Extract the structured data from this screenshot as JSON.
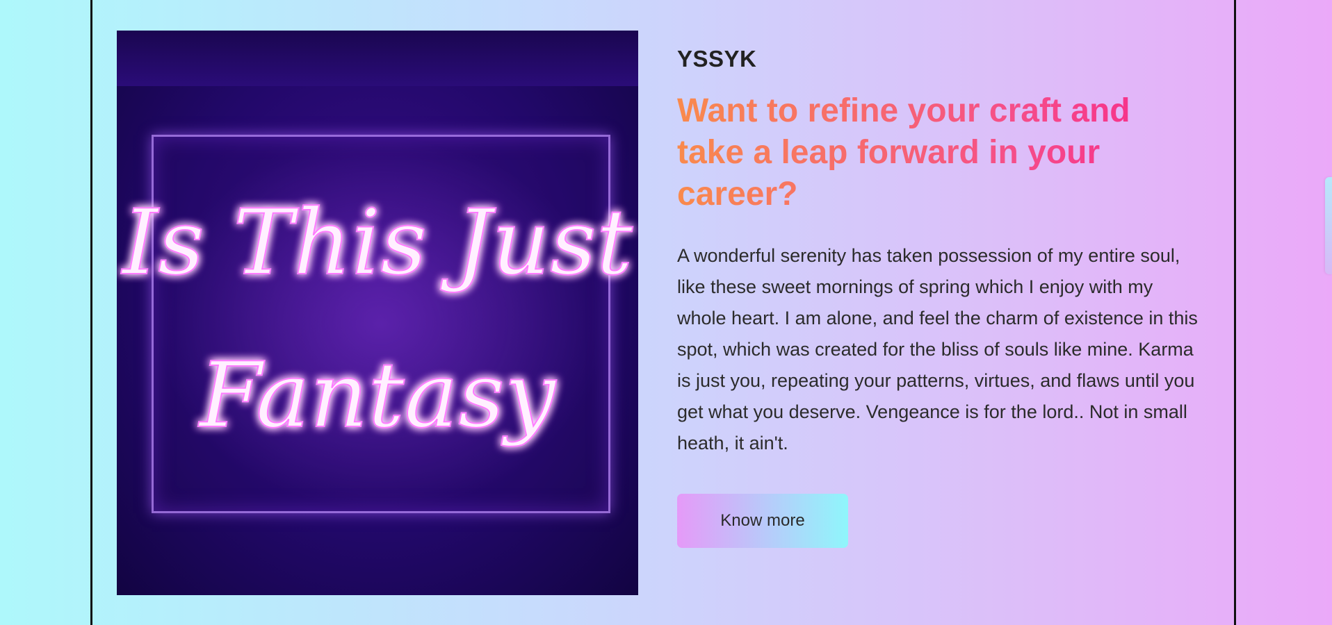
{
  "section": {
    "brand": "YSSYK",
    "headline": "Want to refine your craft and take a leap forward in your career?",
    "body": "A wonderful serenity has taken possession of my entire soul, like these sweet mornings of spring which I enjoy with my whole heart. I am alone, and feel the charm of existence in this spot, which was created for the bliss of souls like mine. Karma is just you, repeating your patterns, virtues, and flaws until you get what you deserve. Vengeance is for the lord.. Not in small heath, it ain't.",
    "cta_label": "Know more"
  },
  "image": {
    "neon_line_1": "Is This Just",
    "neon_line_2": "Fantasy",
    "subject": "neon-sign-photo"
  },
  "colors": {
    "headline_start": "#f98a4c",
    "headline_end": "#f72d8a",
    "neon": "#ffb6ff",
    "cta_start": "#e59af8",
    "cta_end": "#8ff6fb"
  }
}
